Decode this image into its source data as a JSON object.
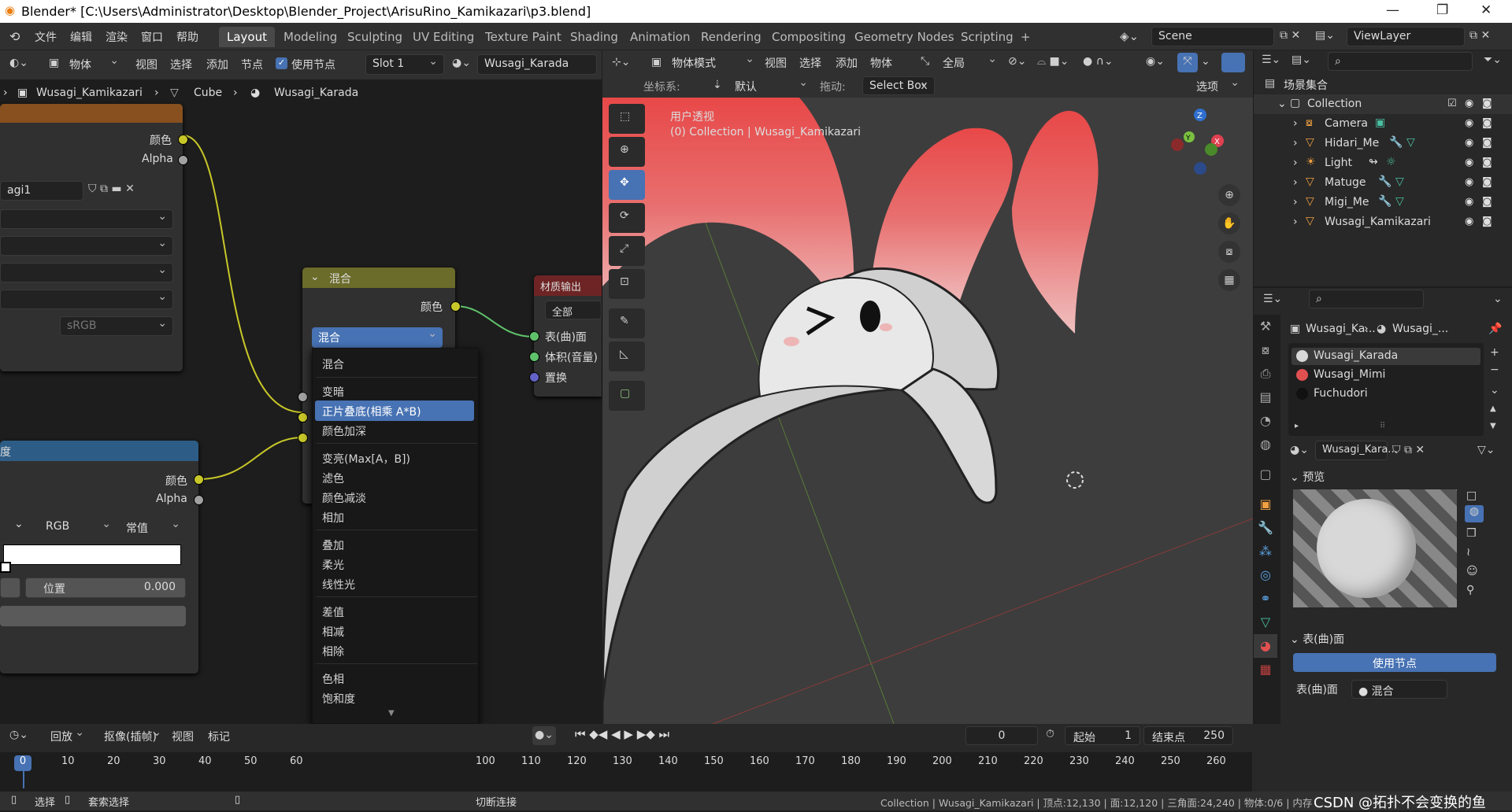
{
  "title": {
    "text": "Blender* [C:\\Users\\Administrator\\Desktop\\Blender_Project\\ArisuRino_Kamikazari\\p3.blend]"
  },
  "menu": {
    "file": "文件",
    "edit": "编辑",
    "render": "渲染",
    "window": "窗口",
    "help": "帮助"
  },
  "workspaces": [
    "Layout",
    "Modeling",
    "Sculpting",
    "UV Editing",
    "Texture Paint",
    "Shading",
    "Animation",
    "Rendering",
    "Compositing",
    "Geometry Nodes",
    "Scripting",
    "+"
  ],
  "scene": {
    "label": "Scene",
    "viewlayer": "ViewLayer"
  },
  "node_header": {
    "object": "物体",
    "view": "视图",
    "select": "选择",
    "add": "添加",
    "node": "节点",
    "use_nodes": "使用节点",
    "slot": "Slot 1",
    "material": "Wusagi_Karada"
  },
  "breadcrumb": {
    "obj": "Wusagi_Kamikazari",
    "mesh": "Cube",
    "mat": "Wusagi_Karada"
  },
  "node_tex": {
    "color": "颜色",
    "alpha": "Alpha",
    "img": "agi1",
    "colorspace": "sRGB"
  },
  "node_ramp": {
    "color": "颜色",
    "alpha": "Alpha",
    "mode": "RGB",
    "interp": "常值",
    "pos_label": "位置",
    "pos_value": "0.000",
    "partial": "度"
  },
  "node_mix": {
    "title": "混合",
    "out": "颜色",
    "blend": "混合"
  },
  "node_out": {
    "title": "材质输出",
    "target": "全部",
    "surface": "表(曲)面",
    "volume": "体积(音量)",
    "disp": "置换"
  },
  "blend_menu": [
    "混合",
    "变暗",
    "正片叠底(相乘 A*B)",
    "颜色加深",
    "变亮(Max[A，B])",
    "滤色",
    "颜色减淡",
    "相加",
    "叠加",
    "柔光",
    "线性光",
    "差值",
    "相减",
    "相除",
    "色相",
    "饱和度"
  ],
  "vp_header": {
    "mode": "物体模式",
    "view": "视图",
    "select": "选择",
    "add": "添加",
    "object": "物体",
    "global": "全局",
    "coord": "坐标系:",
    "coord_val": "默认",
    "drag": "拖动:",
    "drag_val": "Select Box",
    "options": "选项"
  },
  "vp_overlay": {
    "persp": "用户透视",
    "coll": "(0) Collection | Wusagi_Kamikazari"
  },
  "outliner": {
    "root": "场景集合",
    "collection": "Collection",
    "items": [
      "Camera",
      "Hidari_Me",
      "Light",
      "Matuge",
      "Migi_Me",
      "Wusagi_Kamikazari"
    ]
  },
  "props": {
    "crumb1": "Wusagi_Ka...",
    "crumb2": "Wusagi_...",
    "slots": [
      "Wusagi_Karada",
      "Wusagi_Mimi",
      "Fuchudori"
    ],
    "slot_colors": [
      "#d8d8d8",
      "#e05050",
      "#111111"
    ],
    "matname": "Wusagi_Kara...",
    "preview": "预览",
    "surface": "表(曲)面",
    "usenodes": "使用节点",
    "surf_label": "表(曲)面",
    "surf_val": "混合"
  },
  "timeline": {
    "play": "回放",
    "key": "抠像(插帧)",
    "view": "视图",
    "marker": "标记",
    "frame": "0",
    "start_label": "起始",
    "start": "1",
    "end_label": "结束点",
    "end": "250",
    "ticks": [
      "0",
      "10",
      "20",
      "30",
      "40",
      "50",
      "60",
      "100",
      "110",
      "120",
      "130",
      "140",
      "150",
      "160",
      "170",
      "180",
      "190",
      "200",
      "210",
      "220",
      "230",
      "240",
      "250",
      "260"
    ]
  },
  "status": {
    "select": "选择",
    "box": "套索选择",
    "cut": "切断连接",
    "info": "Collection | Wusagi_Kamikazari | 顶点:12,130 | 面:12,120 | 三角面:24,240 | 物体:0/6 | 内存",
    "watermark": "CSDN @拓扑不会变换的鱼"
  },
  "colors": {
    "accent": "#4772b3",
    "mix_header": "#6b6b2a",
    "tex_header": "#87501e",
    "ramp_header": "#2d5d86"
  }
}
